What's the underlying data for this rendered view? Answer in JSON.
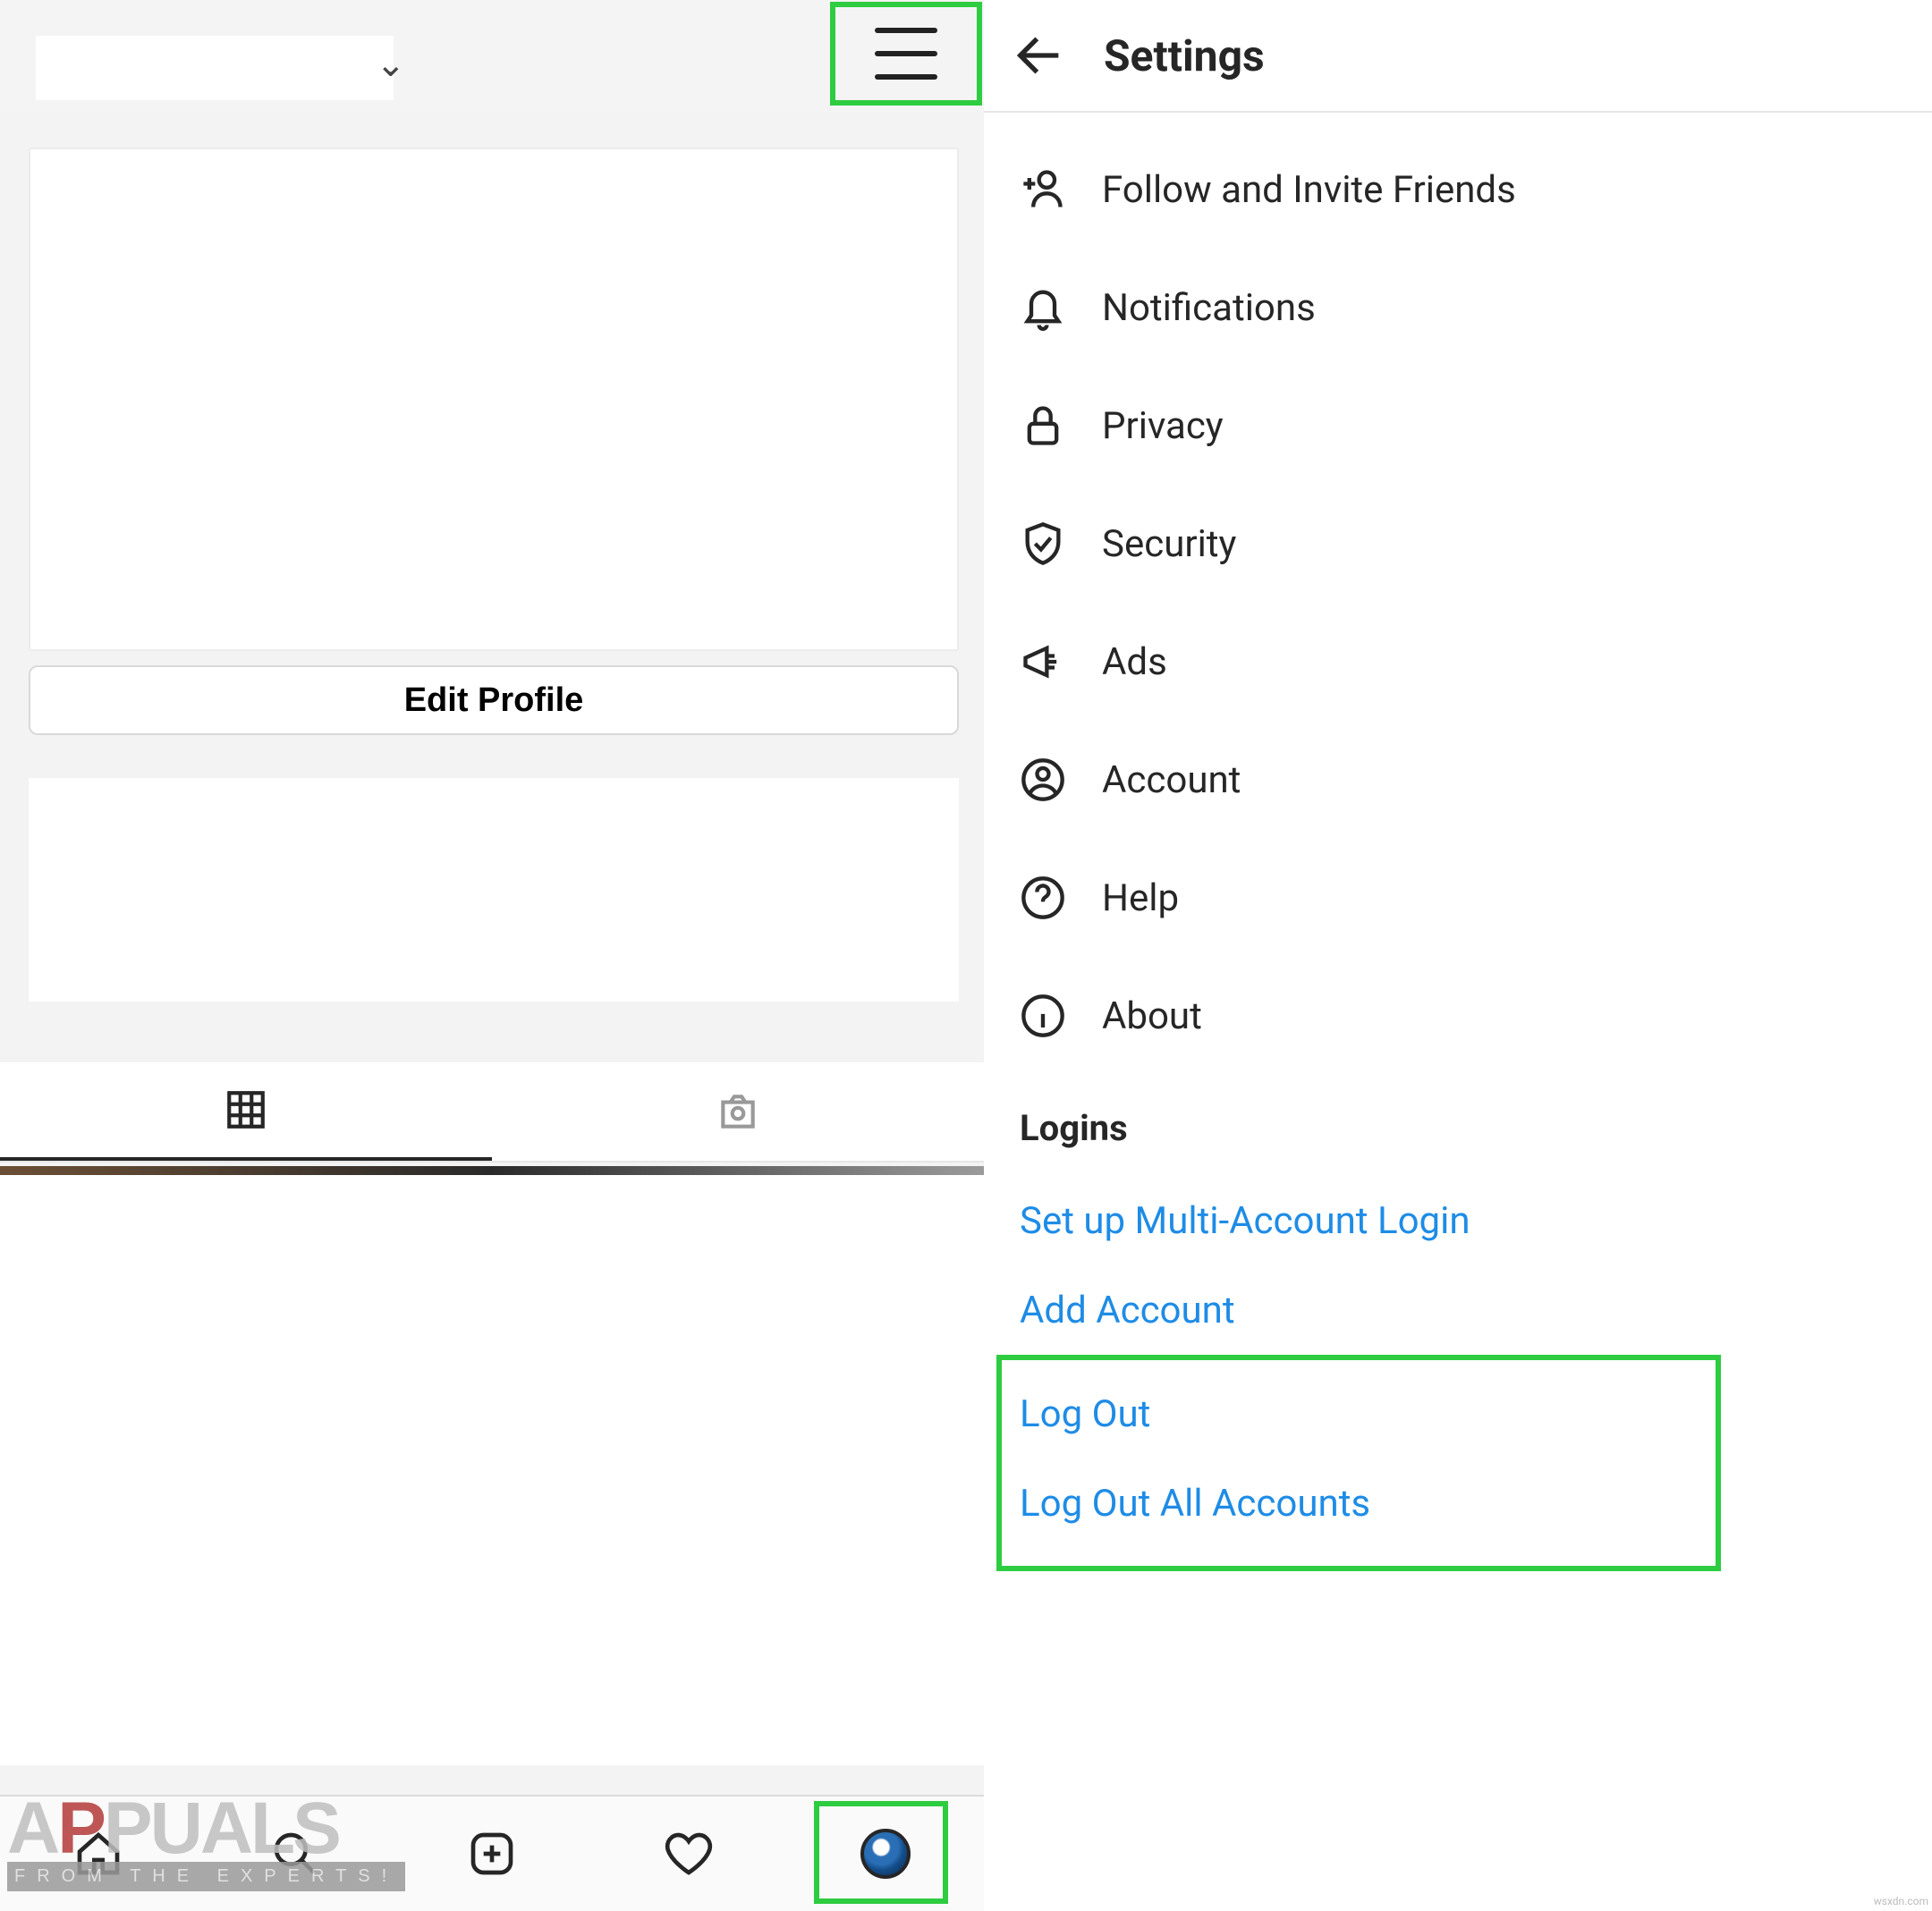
{
  "left": {
    "account_switcher_caret": "⌄",
    "edit_profile_label": "Edit Profile"
  },
  "right": {
    "header_title": "Settings",
    "menu": [
      {
        "icon": "follow-invite-icon",
        "label": "Follow and Invite Friends"
      },
      {
        "icon": "bell-icon",
        "label": "Notifications"
      },
      {
        "icon": "lock-icon",
        "label": "Privacy"
      },
      {
        "icon": "shield-check-icon",
        "label": "Security"
      },
      {
        "icon": "megaphone-icon",
        "label": "Ads"
      },
      {
        "icon": "account-circle-icon",
        "label": "Account"
      },
      {
        "icon": "help-circle-icon",
        "label": "Help"
      },
      {
        "icon": "info-circle-icon",
        "label": "About"
      }
    ],
    "logins_heading": "Logins",
    "links": {
      "setup_multi": "Set up Multi-Account Login",
      "add_account": "Add Account",
      "logout": "Log Out",
      "logout_all": "Log Out All Accounts"
    }
  },
  "watermark": {
    "brand": "APPUALS",
    "tagline": "FROM THE EXPERTS!",
    "credit": "wsxdn.com"
  }
}
